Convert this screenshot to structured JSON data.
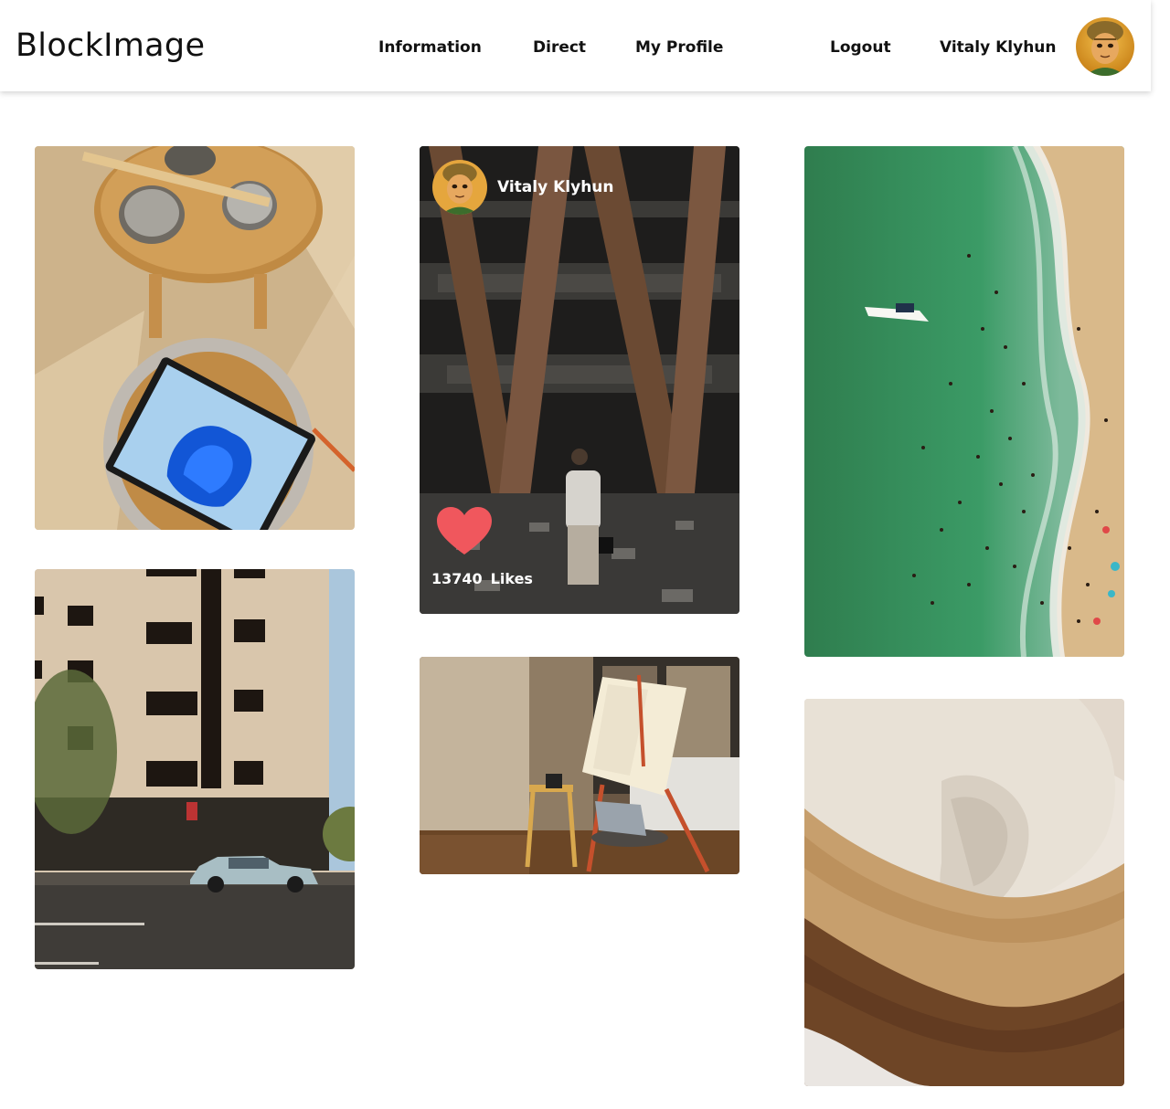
{
  "header": {
    "brand": "BlockImage",
    "nav": {
      "information": "Information",
      "direct": "Direct",
      "my_profile": "My Profile",
      "logout": "Logout",
      "username": "Vitaly Klyhun"
    }
  },
  "feed": {
    "featured": {
      "user_name": "Vitaly Klyhun",
      "likes_count": "13740",
      "likes_label": "Likes"
    }
  },
  "colors": {
    "heart": "#f0575d",
    "header_shadow": "rgba(0,0,0,0.18)"
  }
}
